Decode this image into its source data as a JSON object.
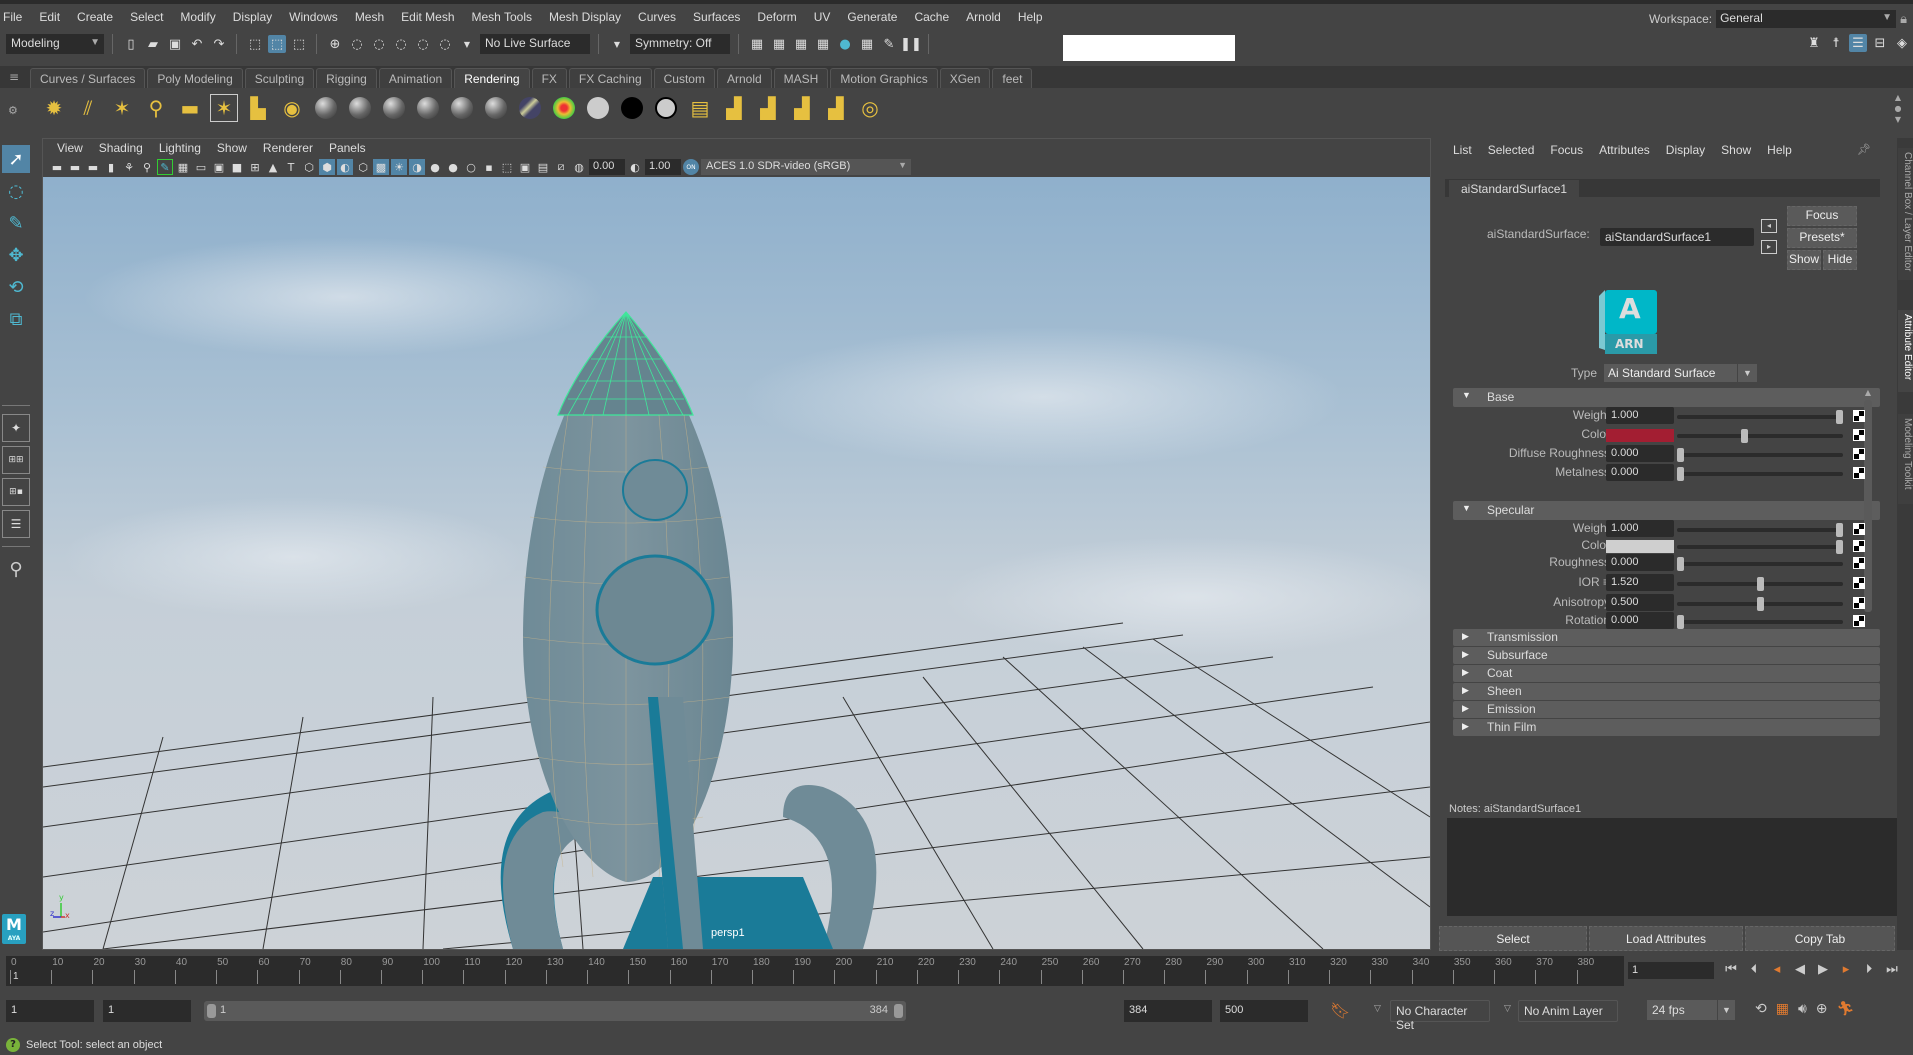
{
  "menubar": {
    "items": [
      "File",
      "Edit",
      "Create",
      "Select",
      "Modify",
      "Display",
      "Windows",
      "Mesh",
      "Edit Mesh",
      "Mesh Tools",
      "Mesh Display",
      "Curves",
      "Surfaces",
      "Deform",
      "UV",
      "Generate",
      "Cache",
      "Arnold",
      "Help"
    ],
    "workspace_label": "Workspace:",
    "workspace_value": "General"
  },
  "statusline": {
    "menuset": "Modeling",
    "live_surface": "No Live Surface",
    "symmetry": "Symmetry: Off"
  },
  "shelf": {
    "tabs": [
      "Curves / Surfaces",
      "Poly Modeling",
      "Sculpting",
      "Rigging",
      "Animation",
      "Rendering",
      "FX",
      "FX Caching",
      "Custom",
      "Arnold",
      "MASH",
      "Motion Graphics",
      "XGen",
      "feet"
    ],
    "active_tab": "Rendering"
  },
  "viewport": {
    "menu": [
      "View",
      "Shading",
      "Lighting",
      "Show",
      "Renderer",
      "Panels"
    ],
    "exposure": "0.00",
    "gamma": "1.00",
    "color_space": "ACES 1.0 SDR-video (sRGB)",
    "camera_label": "persp1",
    "axis": {
      "y": "y",
      "z": "z",
      "x": "x"
    }
  },
  "attribute_editor": {
    "menu": [
      "List",
      "Selected",
      "Focus",
      "Attributes",
      "Display",
      "Show",
      "Help"
    ],
    "node_tab": "aiStandardSurface1",
    "node_type_label": "aiStandardSurface:",
    "node_name": "aiStandardSurface1",
    "buttons": {
      "focus": "Focus",
      "presets": "Presets*",
      "show": "Show",
      "hide": "Hide"
    },
    "logo_text": "ARN",
    "logo_letter": "A",
    "type_label": "Type",
    "type_value": "Ai Standard Surface",
    "sections": {
      "base": {
        "title": "Base",
        "rows": [
          {
            "label": "Weight",
            "value": "1.000",
            "slider": 1.0
          },
          {
            "label": "Color",
            "color": "#a31e32",
            "slider": 0.4
          },
          {
            "label": "Diffuse Roughness",
            "value": "0.000",
            "slider": 0.0
          },
          {
            "label": "Metalness",
            "value": "0.000",
            "slider": 0.0
          }
        ]
      },
      "specular": {
        "title": "Specular",
        "rows": [
          {
            "label": "Weight",
            "value": "1.000",
            "slider": 1.0
          },
          {
            "label": "Color",
            "color": "#cfcfcf",
            "slider": 1.0
          },
          {
            "label": "Roughness",
            "value": "0.000",
            "slider": 0.0
          },
          {
            "label": "IOR ≡",
            "value": "1.520",
            "slider": 0.5
          },
          {
            "label": "Anisotropy",
            "value": "0.500",
            "slider": 0.5
          },
          {
            "label": "Rotation",
            "value": "0.000",
            "slider": 0.0
          }
        ]
      },
      "collapsed": [
        "Transmission",
        "Subsurface",
        "Coat",
        "Sheen",
        "Emission",
        "Thin Film"
      ]
    },
    "notes_label": "Notes:  aiStandardSurface1",
    "bottom_buttons": [
      "Select",
      "Load Attributes",
      "Copy Tab"
    ]
  },
  "side_tabs": [
    "Channel Box / Layer Editor",
    "Attribute Editor",
    "Modeling Toolkit"
  ],
  "timeline": {
    "ticks": [
      0,
      10,
      20,
      30,
      40,
      50,
      60,
      70,
      80,
      90,
      100,
      110,
      120,
      130,
      140,
      150,
      160,
      170,
      180,
      190,
      200,
      210,
      220,
      230,
      240,
      250,
      260,
      270,
      280,
      290,
      300,
      310,
      320,
      330,
      340,
      350,
      360,
      370,
      380
    ],
    "current_marker": "1",
    "current_frame": "1"
  },
  "range": {
    "start": "1",
    "playback_start": "1",
    "slider_start": "1",
    "slider_end": "384",
    "playback_end": "384",
    "end": "500",
    "character_set": "No Character Set",
    "anim_layer": "No Anim Layer",
    "fps": "24 fps"
  },
  "helpline": {
    "text": "Select Tool: select an object"
  }
}
